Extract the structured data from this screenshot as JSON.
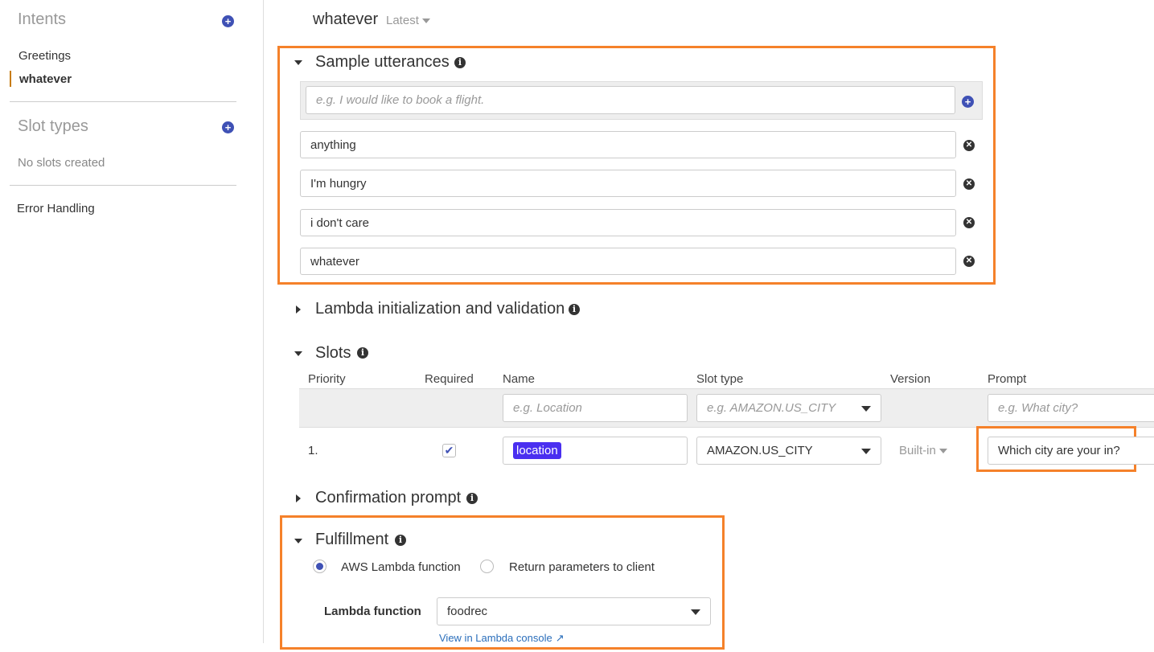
{
  "sidebar": {
    "intents_title": "Intents",
    "intents": [
      {
        "label": "Greetings"
      },
      {
        "label": "whatever",
        "active": true
      }
    ],
    "slot_types_title": "Slot types",
    "no_slots": "No slots created",
    "error_handling": "Error Handling"
  },
  "header": {
    "intent_name": "whatever",
    "version": "Latest"
  },
  "utterances": {
    "title": "Sample utterances",
    "placeholder": "e.g. I would like to book a flight.",
    "items": [
      "anything",
      "I'm hungry",
      "i don't care",
      "whatever"
    ]
  },
  "lambda_init": {
    "title": "Lambda initialization and validation"
  },
  "slots": {
    "title": "Slots",
    "headers": [
      "Priority",
      "Required",
      "Name",
      "Slot type",
      "Version",
      "Prompt"
    ],
    "new_row": {
      "name_placeholder": "e.g. Location",
      "type_placeholder": "e.g. AMAZON.US_CITY",
      "prompt_placeholder": "e.g. What city?"
    },
    "rows": [
      {
        "priority": "1.",
        "required": true,
        "name": "location",
        "slot_type": "AMAZON.US_CITY",
        "version": "Built-in",
        "prompt": "Which city are your in?"
      }
    ]
  },
  "confirmation": {
    "title": "Confirmation prompt"
  },
  "fulfillment": {
    "title": "Fulfillment",
    "options": [
      "AWS Lambda function",
      "Return parameters to client"
    ],
    "selected": "AWS Lambda function",
    "lambda_label": "Lambda function",
    "lambda_value": "foodrec",
    "console_link": "View in Lambda console"
  },
  "colors": {
    "accent": "#3f51b5",
    "highlight": "#f5812a",
    "slot_tag": "#4a2ff0"
  }
}
